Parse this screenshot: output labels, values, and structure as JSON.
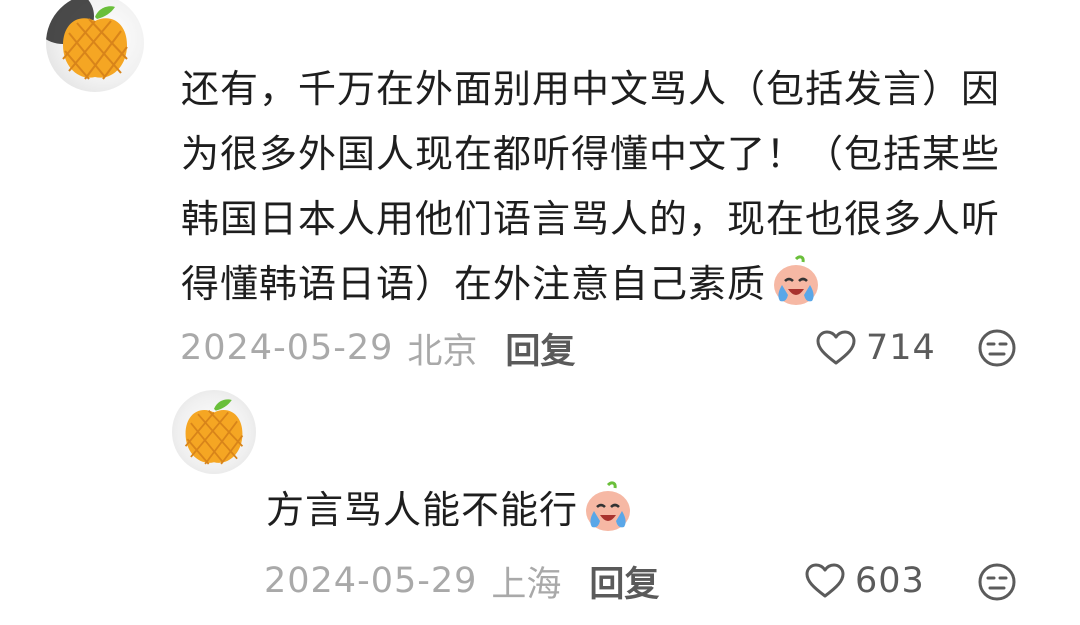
{
  "comments": [
    {
      "text_lines": [
        "还有，千万在外面别用中文骂人（包括发言）因",
        "为很多外国人现在都听得懂中文了！（包括某些",
        "韩国日本人用他们语言骂人的，现在也很多人听",
        "得懂韩语日语）在外注意自己素质"
      ],
      "emoji": "crying-face-sticker",
      "date": "2024-05-29",
      "location": "北京",
      "reply_label": "回复",
      "likes": "714",
      "icons": {
        "like": "heart-outline-icon",
        "dislike": "dislike-face-icon",
        "avatar": "orange-pineapple-apple-avatar"
      }
    },
    {
      "text": "方言骂人能不能行",
      "emoji": "crying-face-sticker",
      "date": "2024-05-29",
      "location": "上海",
      "reply_label": "回复",
      "likes": "603",
      "icons": {
        "like": "heart-outline-icon",
        "dislike": "dislike-face-icon",
        "avatar": "orange-pineapple-apple-avatar"
      }
    }
  ],
  "colors": {
    "text": "#1e1e1e",
    "meta": "#a9a9a9",
    "reply": "#5a5a5a",
    "count": "#5b5b5b",
    "avatar_orange": "#f5a623",
    "avatar_grid": "#d8841a",
    "leaf": "#6abf3a"
  }
}
